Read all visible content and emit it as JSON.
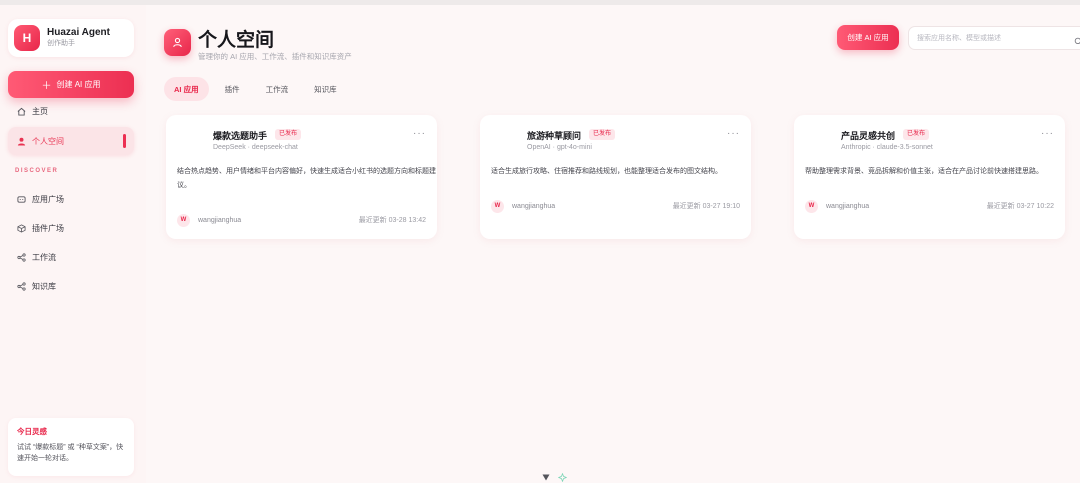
{
  "brand": {
    "logo": "H",
    "name": "Huazai Agent",
    "subtitle": "创作助手"
  },
  "sidebar": {
    "create_label": "创建 AI 应用",
    "home_label": "主页",
    "personal_label": "个人空间",
    "section_label": "DISCOVER",
    "items": [
      {
        "label": "应用广场",
        "icon": "app-icon"
      },
      {
        "label": "插件广场",
        "icon": "cube-icon"
      },
      {
        "label": "工作流",
        "icon": "workflow-icon"
      },
      {
        "label": "知识库",
        "icon": "knowledge-icon"
      }
    ],
    "tip": {
      "title": "今日灵感",
      "text": "试试 “爆款标题” 或 “种草文案”，快速开始一轮对话。"
    }
  },
  "header": {
    "title": "个人空间",
    "subtitle": "管理你的 AI 应用、工作流、插件和知识库资产",
    "create_label": "创建 AI 应用",
    "search_placeholder": "搜索应用名称、模型或描述"
  },
  "tabs": [
    {
      "label": "AI 应用",
      "active": true
    },
    {
      "label": "插件",
      "active": false
    },
    {
      "label": "工作流",
      "active": false
    },
    {
      "label": "知识库",
      "active": false
    }
  ],
  "cards": [
    {
      "name": "爆款选题助手",
      "badge": "已发布",
      "model": "DeepSeek · deepseek-chat",
      "description": "结合热点趋势、用户情绪和平台内容偏好，快速生成适合小红书的选题方向和标题建议。",
      "avatar": "W",
      "author": "wangjianghua",
      "updated": "最近更新 03-28 13:42"
    },
    {
      "name": "旅游种草顾问",
      "badge": "已发布",
      "model": "OpenAI · gpt-4o-mini",
      "description": "适合生成旅行攻略、住宿推荐和路线规划，也能整理适合发布的图文结构。",
      "avatar": "W",
      "author": "wangjianghua",
      "updated": "最近更新 03-27 19:10"
    },
    {
      "name": "产品灵感共创",
      "badge": "已发布",
      "model": "Anthropic · claude-3.5-sonnet",
      "description": "帮助整理需求背景、竞品拆解和价值主张，适合在产品讨论前快速搭建思路。",
      "avatar": "W",
      "author": "wangjianghua",
      "updated": "最近更新 03-27 10:22"
    }
  ],
  "colors": {
    "accent": "#ec2f52",
    "accent_light": "#fde3e7",
    "background": "#fdf7f7"
  }
}
